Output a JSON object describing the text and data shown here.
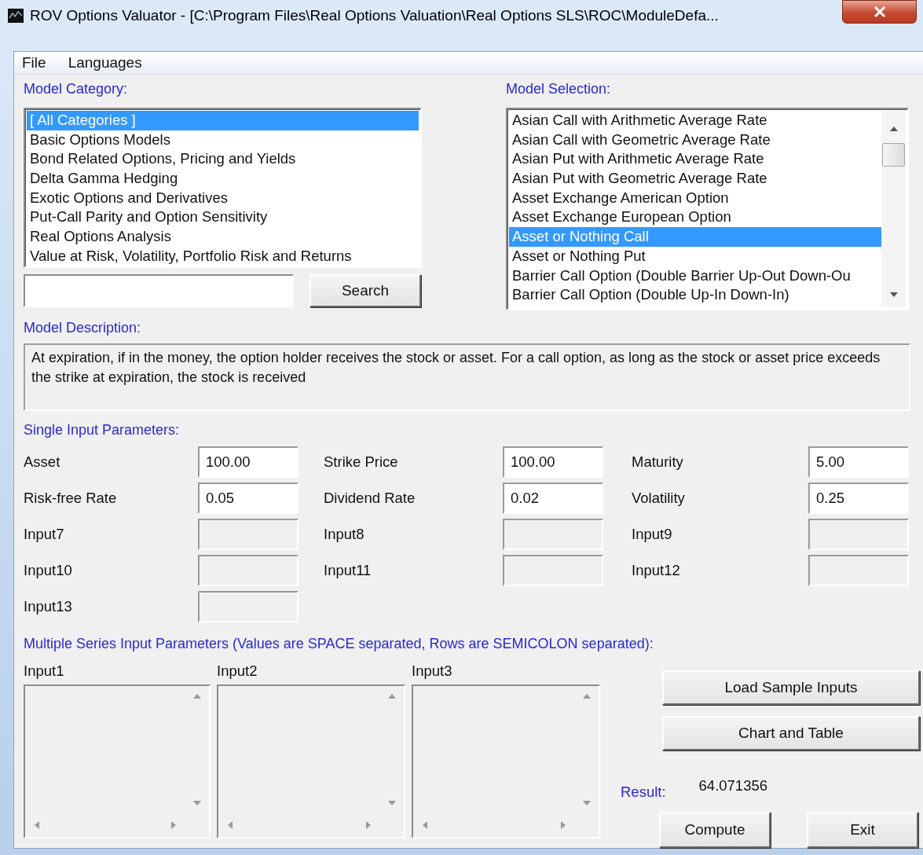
{
  "window": {
    "title": "ROV Options Valuator - [C:\\Program Files\\Real Options Valuation\\Real Options SLS\\ROC\\ModuleDefa..."
  },
  "menu": [
    "File",
    "Languages"
  ],
  "model_category": {
    "label": "Model Category:",
    "items": [
      {
        "text": "[ All Categories ]",
        "selected": true
      },
      {
        "text": "Basic Options Models",
        "selected": false
      },
      {
        "text": "Bond Related Options, Pricing and Yields",
        "selected": false
      },
      {
        "text": "Delta Gamma Hedging",
        "selected": false
      },
      {
        "text": "Exotic Options and Derivatives",
        "selected": false
      },
      {
        "text": "Put-Call Parity and Option Sensitivity",
        "selected": false
      },
      {
        "text": "Real Options Analysis",
        "selected": false
      },
      {
        "text": "Value at Risk, Volatility, Portfolio Risk and Returns",
        "selected": false
      }
    ]
  },
  "search": {
    "button": "Search"
  },
  "model_selection": {
    "label": "Model Selection:",
    "items": [
      {
        "text": "Asian Call with Arithmetic Average Rate",
        "selected": false
      },
      {
        "text": "Asian Call with Geometric Average Rate",
        "selected": false
      },
      {
        "text": "Asian Put with Arithmetic Average Rate",
        "selected": false
      },
      {
        "text": "Asian Put with Geometric Average Rate",
        "selected": false
      },
      {
        "text": "Asset Exchange American Option",
        "selected": false
      },
      {
        "text": "Asset Exchange European Option",
        "selected": false
      },
      {
        "text": "Asset or Nothing Call",
        "selected": true
      },
      {
        "text": "Asset or Nothing Put",
        "selected": false
      },
      {
        "text": "Barrier Call Option (Double Barrier Up-Out Down-Ou",
        "selected": false
      },
      {
        "text": "Barrier Call Option (Double Up-In Down-In)",
        "selected": false
      }
    ]
  },
  "model_description": {
    "label": "Model Description:",
    "text": "At expiration, if in the money, the option holder receives the stock or asset. For a call option, as long as the stock or asset price exceeds the strike at expiration, the stock is received"
  },
  "single_inputs": {
    "label": "Single Input Parameters:",
    "params": [
      {
        "label": "Asset",
        "value": "100.00",
        "disabled": false
      },
      {
        "label": "Strike Price",
        "value": "100.00",
        "disabled": false
      },
      {
        "label": "Maturity",
        "value": "5.00",
        "disabled": false
      },
      {
        "label": "Risk-free Rate",
        "value": "0.05",
        "disabled": false
      },
      {
        "label": "Dividend Rate",
        "value": "0.02",
        "disabled": false
      },
      {
        "label": "Volatility",
        "value": "0.25",
        "disabled": false
      },
      {
        "label": "Input7",
        "disabled": true
      },
      {
        "label": "Input8",
        "disabled": true
      },
      {
        "label": "Input9",
        "disabled": true
      },
      {
        "label": "Input10",
        "disabled": true
      },
      {
        "label": "Input11",
        "disabled": true
      },
      {
        "label": "Input12",
        "disabled": true
      },
      {
        "label": "Input13",
        "disabled": true
      }
    ]
  },
  "multiple_series": {
    "label": "Multiple Series Input Parameters (Values are SPACE separated, Rows are SEMICOLON separated):",
    "inputs": [
      {
        "label": "Input1"
      },
      {
        "label": "Input2"
      },
      {
        "label": "Input3"
      }
    ]
  },
  "side_buttons": [
    "Load Sample Inputs",
    "Chart and Table"
  ],
  "result": {
    "label": "Result:",
    "value": "64.071356"
  },
  "buttons": [
    "Compute",
    "Exit"
  ]
}
